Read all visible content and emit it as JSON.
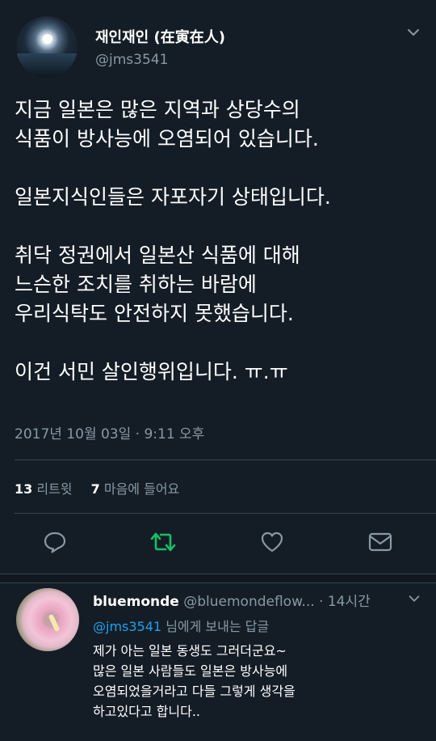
{
  "tweet": {
    "display_name": "재인재인 (在寅在人)",
    "handle": "@jms3541",
    "lines": [
      "지금 일본은 많은 지역과 상당수의",
      "식품이 방사능에 오염되어 있습니다.",
      "",
      "일본지식인들은 자포자기 상태입니다.",
      "",
      "취닥 정권에서 일본산 식품에 대해",
      "느슨한 조치를 취하는 바람에",
      "우리식탁도 안전하지 못했습니다.",
      "",
      "이건 서민 살인행위입니다. ㅠ.ㅠ"
    ],
    "timestamp": "2017년 10월 03일 · 9:11 오후",
    "retweet_count": "13",
    "retweet_label": "리트윗",
    "like_count": "7",
    "like_label": "마음에 들어요"
  },
  "icons": {
    "reply": "reply-icon",
    "retweet": "retweet-icon",
    "like": "heart-icon",
    "dm": "envelope-icon",
    "more": "chevron-down-icon"
  },
  "reply": {
    "display_name": "bluemonde",
    "handle": "@bluemondeflow...",
    "time": "· 14시간",
    "replying_mention": "@jms3541",
    "replying_suffix": "님에게 보내는 답글",
    "lines": [
      "제가 아는 일본 동생도 그러더군요~",
      "많은 일본 사람들도 일본은 방사능에",
      "오염되었을거라고 다들 그렇게 생각을",
      "하고있다고 합니다.."
    ]
  },
  "colors": {
    "background": "#141d26",
    "secondary_text": "#8899a6",
    "retweet_active": "#17bf63",
    "link": "#1da1f2"
  }
}
